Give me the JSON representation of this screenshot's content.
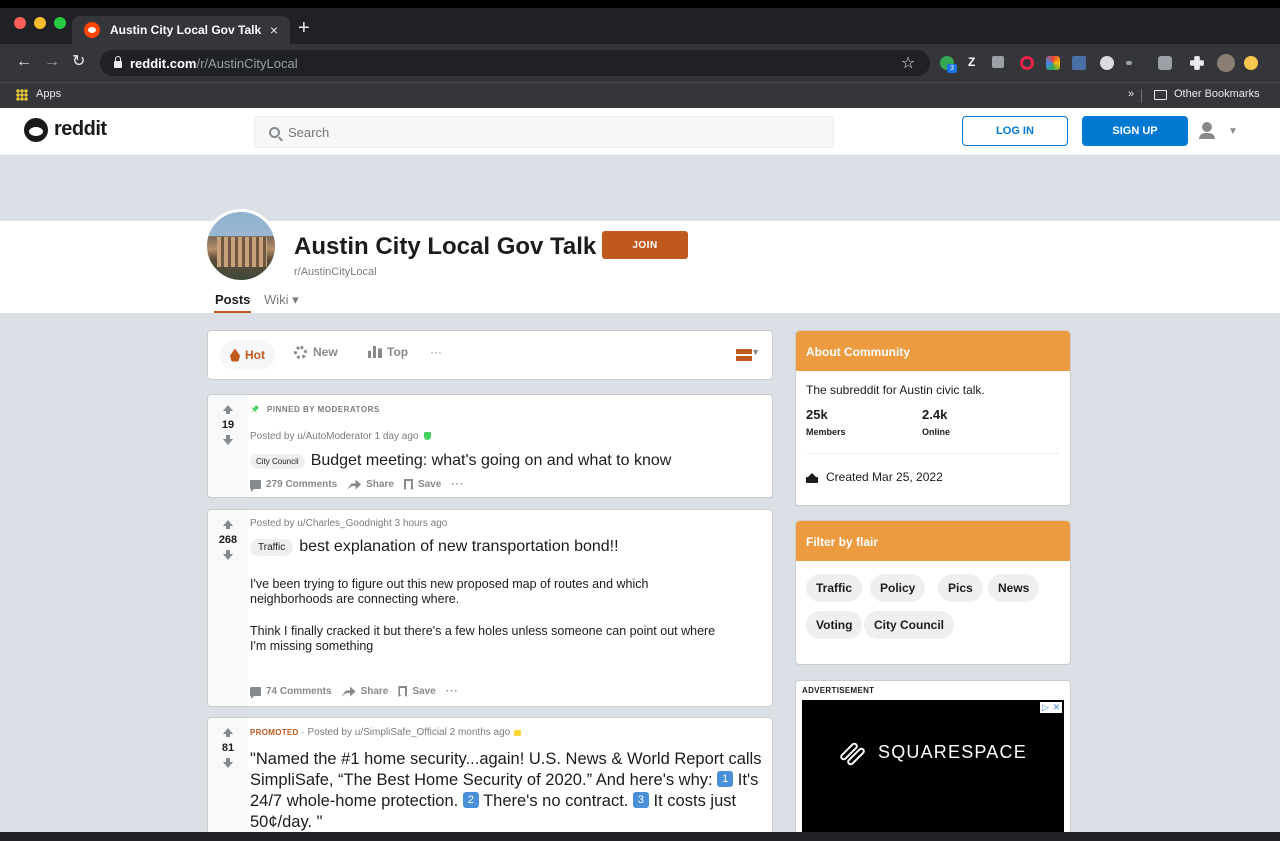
{
  "browser": {
    "tab_title": "Austin City Local Gov Talk",
    "close_glyph": "×",
    "new_tab_glyph": "+",
    "url_domain": "reddit.com",
    "url_path": "/r/AustinCityLocal",
    "bookmarks_apps": "Apps",
    "bookmarks_overflow": "»",
    "other_bookmarks": "Other Bookmarks",
    "extension_letter": "Z",
    "extension_badge": "3",
    "icons": [
      "back-arrow-icon",
      "forward-arrow-icon",
      "reload-icon",
      "lock-icon",
      "star-icon",
      "folder-icon"
    ]
  },
  "reddit_header": {
    "logo_text": "reddit",
    "search_placeholder": "Search",
    "login_label": "LOG IN",
    "signup_label": "SIGN UP",
    "accent": "#0079d3"
  },
  "community": {
    "title": "Austin City Local Gov Talk",
    "slug": "r/AustinCityLocal",
    "join_label": "JOIN",
    "tabs": [
      {
        "label": "Posts",
        "active": true
      },
      {
        "label": "Wiki ▾",
        "active": false
      }
    ],
    "accent": "#c0591e"
  },
  "sort": {
    "hot": "Hot",
    "new": "New",
    "top": "Top",
    "more": "···"
  },
  "posts": [
    {
      "pinned_label": "PINNED BY MODERATORS",
      "score": "19",
      "meta": "Posted by u/AutoModerator 1 day ago",
      "flair": "City Council",
      "title": "Budget meeting: what's going on and what to know",
      "comments": "279 Comments",
      "share": "Share",
      "save": "Save",
      "more": "···"
    },
    {
      "score": "268",
      "meta": "Posted by u/Charles_Goodnight 3 hours ago",
      "flair": "Traffic",
      "title": "best explanation of new transportation bond!!",
      "body_1": "I've been trying to figure out this new proposed map of routes and which neighborhoods are connecting where.",
      "body_2": "Think I finally cracked it but there's a few holes unless someone can point out where I'm missing something",
      "comments": "74 Comments",
      "share": "Share",
      "save": "Save",
      "more": "···"
    },
    {
      "score": "81",
      "promoted": "PROMOTED",
      "meta": " · Posted by u/SimpliSafe_Official 2 months ago",
      "title_a": "\"Named the #1 home security...again! U.S. News & World Report calls SimpliSafe, “The Best Home Security of 2020.” And here's why: ",
      "key_1": "1",
      "title_b": " It's 24/7 whole-home protection. ",
      "key_2": "2",
      "title_c": " There's no contract. ",
      "key_3": "3",
      "title_d": " It costs just 50¢/day. \""
    }
  ],
  "sidebar": {
    "about_title": "About Community",
    "description": "The subreddit for Austin civic talk.",
    "members_count": "25k",
    "members_label": "Members",
    "online_count": "2.4k",
    "online_label": "Online",
    "created": "Created Mar 25, 2022",
    "flair_title": "Filter by flair",
    "flairs": [
      "Traffic",
      "Policy",
      "Pics",
      "News",
      "Voting",
      "City Council"
    ],
    "header_color": "#ed9b40",
    "ad_label": "ADVERTISEMENT",
    "ad_brand": "SQUARESPACE",
    "ad_corner_left": "▷",
    "ad_corner_right": "✕"
  }
}
